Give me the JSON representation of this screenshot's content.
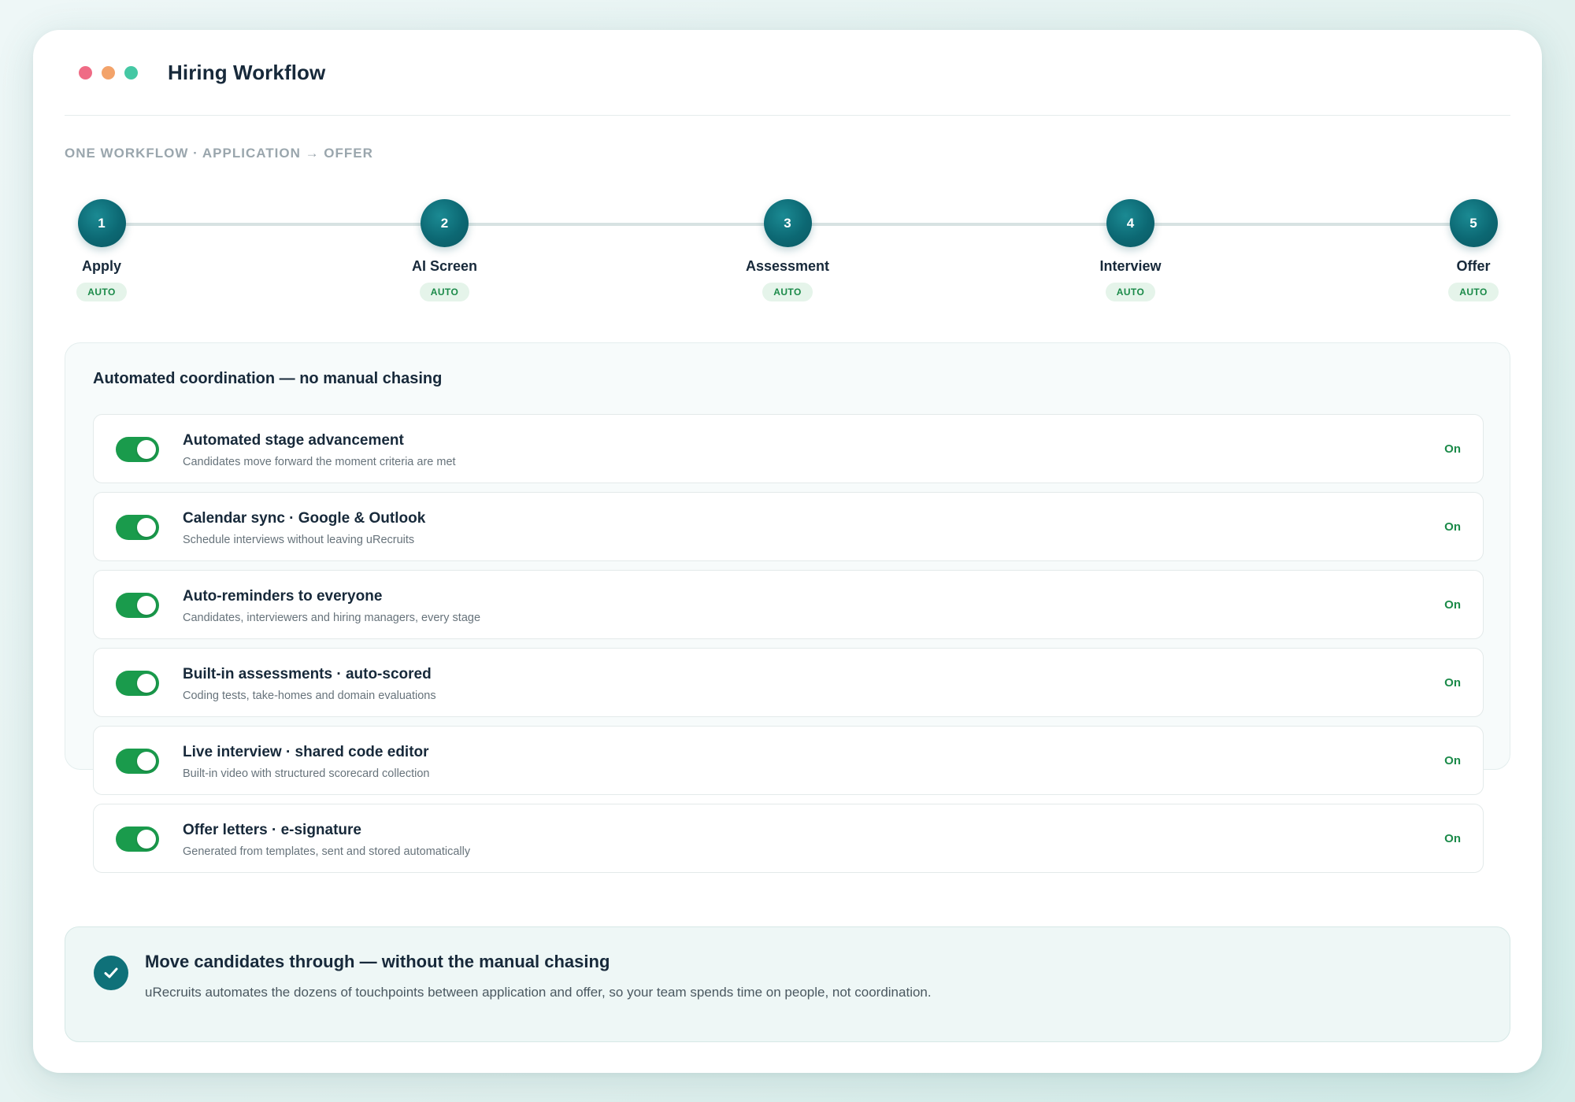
{
  "window": {
    "title": "Hiring Workflow",
    "controls": [
      "close-dot",
      "minimize-dot",
      "maximize-dot"
    ]
  },
  "subtitle": "ONE WORKFLOW · APPLICATION → OFFER",
  "steps": [
    {
      "number": "1",
      "label": "Apply",
      "badge": "AUTO"
    },
    {
      "number": "2",
      "label": "AI Screen",
      "badge": "AUTO"
    },
    {
      "number": "3",
      "label": "Assessment",
      "badge": "AUTO"
    },
    {
      "number": "4",
      "label": "Interview",
      "badge": "AUTO"
    },
    {
      "number": "5",
      "label": "Offer",
      "badge": "AUTO"
    }
  ],
  "panel": {
    "title": "Automated coordination — no manual chasing",
    "rows": [
      {
        "title": "Automated stage advancement",
        "desc": "Candidates move forward the moment criteria are met",
        "status": "On",
        "enabled": true
      },
      {
        "title": "Calendar sync · Google & Outlook",
        "desc": "Schedule interviews without leaving uRecruits",
        "status": "On",
        "enabled": true
      },
      {
        "title": "Auto-reminders to everyone",
        "desc": "Candidates, interviewers and hiring managers, every stage",
        "status": "On",
        "enabled": true
      },
      {
        "title": "Built-in assessments · auto-scored",
        "desc": "Coding tests, take-homes and domain evaluations",
        "status": "On",
        "enabled": true
      },
      {
        "title": "Live interview · shared code editor",
        "desc": "Built-in video with structured scorecard collection",
        "status": "On",
        "enabled": true
      },
      {
        "title": "Offer letters · e-signature",
        "desc": "Generated from templates, sent and stored automatically",
        "status": "On",
        "enabled": true
      }
    ]
  },
  "callout": {
    "icon": "check-icon",
    "title": "Move candidates through — without the manual chasing",
    "desc": "uRecruits automates the dozens of touchpoints between application and offer, so your team spends time on people, not coordination."
  },
  "colors": {
    "accent": "#0c6873",
    "toggle_on": "#1a9b4c",
    "status_on": "#1b8a49",
    "dot_red": "#ef6b85",
    "dot_orange": "#f3a36a",
    "dot_green": "#45c8a4"
  }
}
